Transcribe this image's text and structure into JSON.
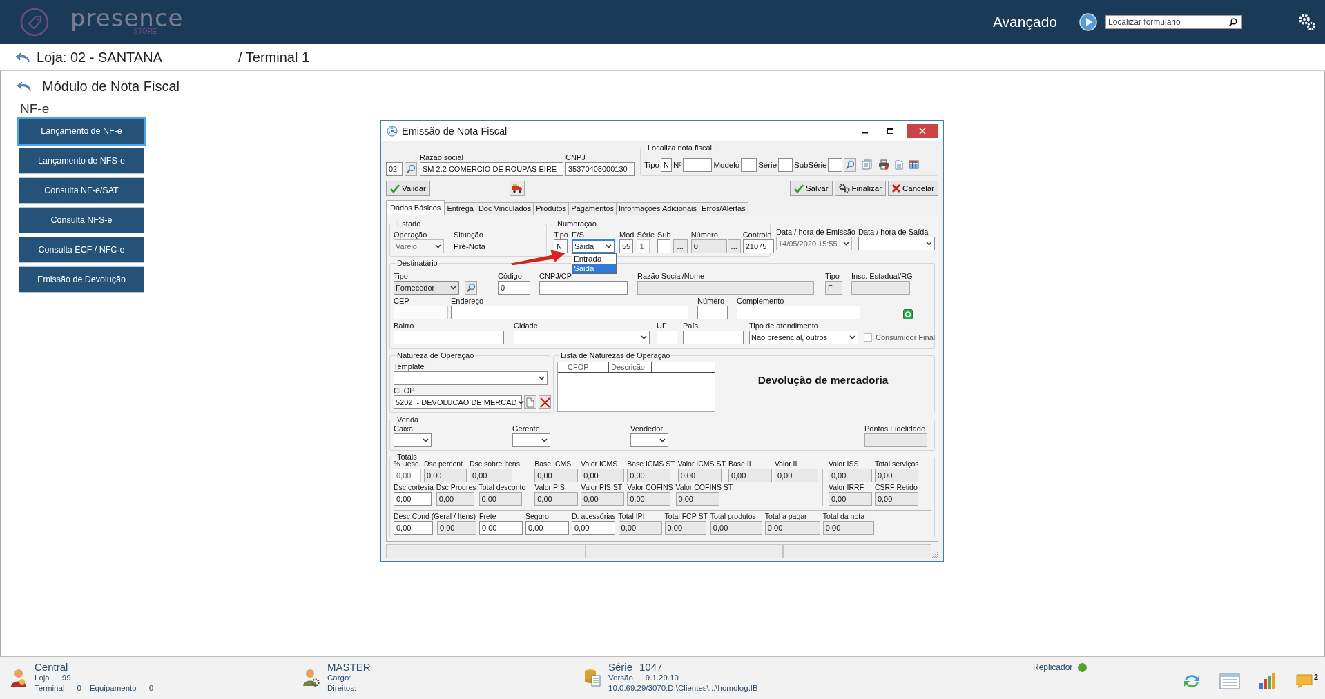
{
  "header": {
    "logo": "presence",
    "logo_tagline": "STORE",
    "mode": "Avançado",
    "search_placeholder": "Localizar formulário"
  },
  "breadcrumb": {
    "store": "Loja: 02 - SANTANA",
    "terminal": "/ Terminal 1"
  },
  "module": {
    "title": "Módulo de Nota Fiscal",
    "section": "NF-e",
    "menu": [
      {
        "label": "Lançamento de NF-e",
        "selected": true
      },
      {
        "label": "Lançamento de NFS-e",
        "selected": false
      },
      {
        "label": "Consulta NF-e/SAT",
        "selected": false
      },
      {
        "label": "Consulta NFS-e",
        "selected": false
      },
      {
        "label": "Consulta ECF / NFC-e",
        "selected": false
      },
      {
        "label": "Emissão de Devolução",
        "selected": false
      }
    ]
  },
  "dialog": {
    "title": "Emissão de Nota Fiscal",
    "company": [
      {
        "value": "02",
        "kind": "input"
      },
      {
        "kind": "lookup"
      },
      {
        "label": "Razão social",
        "value": "SM 2.2 COMERCIO DE ROUPAS EIRE",
        "kind": "input"
      },
      {
        "label": "CNPJ",
        "value": "35370408000130",
        "kind": "input"
      }
    ],
    "locate": {
      "title": "Localiza nota fiscal",
      "fields": [
        {
          "label": "Tipo",
          "value": "N",
          "kind": "input"
        },
        {
          "label": "Nº",
          "kind": "input"
        },
        {
          "label": "Modelo",
          "kind": "input"
        },
        {
          "label": "Série",
          "kind": "input"
        },
        {
          "label": "SubSérie",
          "kind": "input"
        },
        {
          "kind": "lookup"
        },
        {
          "kind": "list-doc"
        },
        {
          "kind": "printer"
        },
        {
          "kind": "doc"
        },
        {
          "kind": "grid"
        }
      ]
    },
    "toolbar": {
      "left": [
        {
          "label": "Validar",
          "kind": "check"
        },
        {
          "kind": "truck"
        }
      ],
      "right": [
        {
          "label": "Salvar",
          "kind": "check"
        },
        {
          "label": "Finalizar",
          "kind": "gears"
        },
        {
          "label": "Cancelar",
          "kind": "cancel"
        }
      ]
    },
    "tabs": [
      {
        "label": "Dados Básicos",
        "selected": true
      },
      {
        "label": "Entrega",
        "selected": false
      },
      {
        "label": "Doc Vinculados",
        "selected": false
      },
      {
        "label": "Produtos",
        "selected": false
      },
      {
        "label": "Pagamentos",
        "selected": false
      },
      {
        "label": "Informações Adicionais",
        "selected": false
      },
      {
        "label": "Erros/Alertas",
        "selected": false
      }
    ],
    "estado": {
      "title": "Estado",
      "fields": [
        {
          "label": "Operação",
          "value": "Varejo",
          "kind": "select-disabled"
        },
        {
          "label": "Situação",
          "value": "Pré-Nota",
          "kind": "text"
        }
      ]
    },
    "numeracao": {
      "title": "Numeração",
      "fields": [
        {
          "label": "Tipo",
          "value": "N",
          "kind": "input"
        },
        {
          "label": "E/S",
          "value": "Saida",
          "kind": "select",
          "expanded": true,
          "options": [
            {
              "label": "Entrada",
              "selected": false
            },
            {
              "label": "Saida",
              "selected": true
            }
          ]
        },
        {
          "label": "Mod",
          "value": "55",
          "kind": "input"
        },
        {
          "label": "Série",
          "value": "1",
          "kind": "disabled"
        },
        {
          "label": "Sub",
          "kind": "input"
        },
        {
          "value": "...",
          "kind": "dots"
        },
        {
          "label": "Número",
          "value": "0",
          "kind": "readonly"
        },
        {
          "value": "...",
          "kind": "dots"
        },
        {
          "label": "Controle",
          "value": "21075",
          "kind": "input"
        }
      ]
    },
    "dates": [
      {
        "label": "Data / hora de Emissão",
        "value": "14/05/2020 15:55",
        "kind": "select-disabled"
      },
      {
        "label": "Data / hora de Saída",
        "kind": "select"
      }
    ],
    "destinatario": {
      "title": "Destinatário",
      "lines": [
        {
          "fields": [
            {
              "label": "Tipo",
              "value": "Fornecedor",
              "kind": "select-grey"
            },
            {
              "kind": "lookup"
            },
            {
              "label": "Código",
              "value": "0",
              "kind": "input"
            },
            {
              "label": "CNPJ/CP",
              "kind": "input"
            },
            {
              "label": "Razão Social/Nome",
              "kind": "readonly"
            },
            {
              "label": "Tipo",
              "value": "F",
              "kind": "readonly"
            },
            {
              "label": "Insc. Estadual/RG",
              "kind": "readonly"
            }
          ]
        },
        {
          "fields": [
            {
              "label": "CEP",
              "kind": "disabled"
            },
            {
              "label": "Endereço",
              "kind": "input"
            },
            {
              "label": "Número",
              "kind": "input"
            },
            {
              "label": "Complemento",
              "kind": "input"
            },
            {
              "kind": "money"
            }
          ]
        },
        {
          "fields": [
            {
              "label": "Bairro",
              "kind": "input"
            },
            {
              "label": "Cidade",
              "kind": "select"
            },
            {
              "label": "UF",
              "kind": "input"
            },
            {
              "label": "País",
              "kind": "input"
            },
            {
              "label": "Tipo de atendimento",
              "value": "Não presencial, outros",
              "kind": "select"
            },
            {
              "label": "Consumidor Final",
              "kind": "checkbox",
              "checked": false
            }
          ]
        }
      ]
    },
    "natureza": {
      "title": "Natureza de Operação",
      "rows": [
        [
          {
            "label": "Template",
            "kind": "select"
          }
        ],
        [
          {
            "label": "CFOP",
            "value": "5202  - DEVOLUCAO DE MERCAD",
            "kind": "select"
          },
          {
            "kind": "doc-button"
          },
          {
            "kind": "delete"
          }
        ]
      ]
    },
    "naturezas_list": {
      "title": "Lista de Naturezas de Operação",
      "columns": [
        "CFOP",
        "Descrição"
      ],
      "highlight": "Devolução de mercadoria"
    },
    "venda": {
      "title": "Venda",
      "fields": [
        {
          "label": "Caixa",
          "kind": "select"
        },
        {
          "label": "Gerente",
          "kind": "select"
        },
        {
          "label": "Vendedor",
          "kind": "select"
        },
        {
          "label": "Pontos Fidelidade",
          "kind": "readonly"
        }
      ]
    },
    "totais": {
      "title": "Totais",
      "left": [
        [
          {
            "label": "% Desc.",
            "value": "0,00",
            "kind": "disabled"
          },
          {
            "label": "Dsc percent",
            "value": "0,00",
            "kind": "readonly"
          },
          {
            "label": "Dsc sobre Itens",
            "value": "0,00",
            "kind": "readonly"
          }
        ],
        [
          {
            "label": "Dsc cortesia",
            "value": "0,00",
            "kind": "input"
          },
          {
            "label": "Dsc Progres",
            "value": "0,00",
            "kind": "readonly"
          },
          {
            "label": "Total desconto",
            "value": "0,00",
            "kind": "readonly"
          }
        ]
      ],
      "middle": [
        [
          {
            "label": "Base ICMS",
            "value": "0,00",
            "kind": "readonly"
          },
          {
            "label": "Valor ICMS",
            "value": "0,00",
            "kind": "readonly"
          },
          {
            "label": "Base ICMS ST",
            "value": "0,00",
            "kind": "readonly"
          },
          {
            "label": "Valor ICMS ST",
            "value": "0,00",
            "kind": "readonly"
          },
          {
            "label": "Base II",
            "value": "0,00",
            "kind": "readonly"
          },
          {
            "label": "Valor II",
            "value": "0,00",
            "kind": "readonly"
          }
        ],
        [
          {
            "label": "Valor PIS",
            "value": "0,00",
            "kind": "readonly"
          },
          {
            "label": "Valor PIS ST",
            "value": "0,00",
            "kind": "readonly"
          },
          {
            "label": "Valor COFINS",
            "value": "0,00",
            "kind": "readonly"
          },
          {
            "label": "Valor COFINS ST",
            "value": "0,00",
            "kind": "readonly"
          }
        ]
      ],
      "right": [
        [
          {
            "label": "Valor ISS",
            "value": "0,00",
            "kind": "readonly"
          },
          {
            "label": "Total serviços",
            "value": "0,00",
            "kind": "readonly"
          }
        ],
        [
          {
            "label": "Valor IRRF",
            "value": "0,00",
            "kind": "readonly"
          },
          {
            "label": "CSRF Retido",
            "value": "0,00",
            "kind": "readonly"
          }
        ]
      ],
      "bottom": [
        {
          "label": "Desc Cond (Geral / Itens)",
          "value": "0,00",
          "kind": "input",
          "second": {
            "value": "0,00",
            "kind": "readonly"
          }
        },
        {
          "label": "Frete",
          "value": "0,00",
          "kind": "input"
        },
        {
          "label": "Seguro",
          "value": "0,00",
          "kind": "input"
        },
        {
          "label": "D. acessórias",
          "value": "0,00",
          "kind": "input"
        },
        {
          "label": "Total IPI",
          "value": "0,00",
          "kind": "readonly"
        },
        {
          "label": "Total FCP ST",
          "value": "0,00",
          "kind": "readonly"
        },
        {
          "label": "Total produtos",
          "value": "0,00",
          "kind": "readonly"
        },
        {
          "label": "Total a pagar",
          "value": "0,00",
          "kind": "readonly"
        },
        {
          "label": "Total da nota",
          "value": "0,00",
          "kind": "readonly"
        }
      ]
    }
  },
  "footer": {
    "user": {
      "title": "Central",
      "store_label": "Loja",
      "store": "99",
      "terminal_label": "Terminal",
      "terminal": "0",
      "device_label": "Equipamento",
      "device": "0"
    },
    "role": {
      "title": "MASTER",
      "lines": [
        "Cargo:",
        "Direitos:"
      ]
    },
    "system": {
      "serie_label": "Série",
      "serie": "1047",
      "version_label": "Versão",
      "version": "9.1.29.10",
      "path": "10.0.69.29/3070:D:\\Clientes\\...\\homolog.IB"
    },
    "replicator": {
      "label": "Replicador",
      "online": true
    },
    "notifications": "2"
  }
}
